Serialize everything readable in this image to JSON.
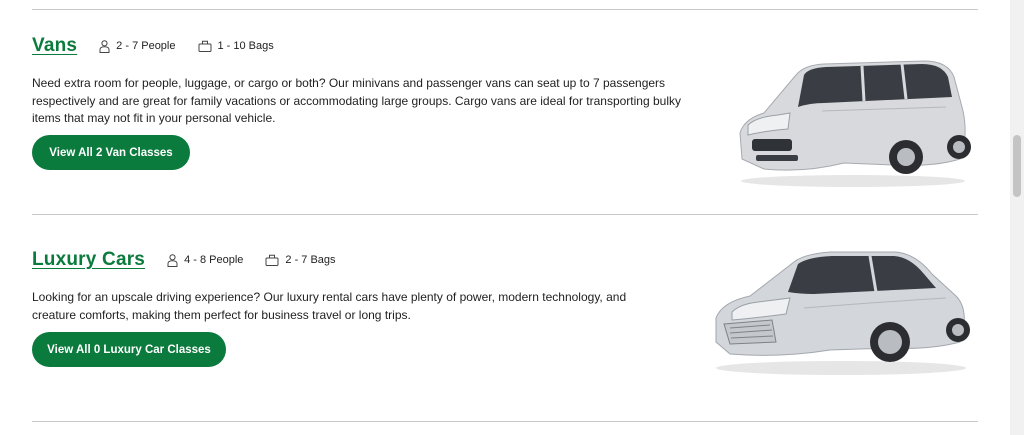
{
  "sections": [
    {
      "title": "Vans",
      "people": "2 - 7 People",
      "bags": "1 - 10 Bags",
      "description_lines": [
        "Need extra room for people, luggage, or cargo or both? Our minivans and passenger vans can seat up to 7 passengers",
        "respectively and are great for family vacations or accommodating large groups. Cargo vans are ideal for transporting bulky",
        "items that may not fit in your personal vehicle."
      ],
      "button_label": "View All 2 Van Classes"
    },
    {
      "title": "Luxury Cars",
      "people": "4 - 8 People",
      "bags": "2 - 7 Bags",
      "description_lines": [
        "Looking for an upscale driving experience? Our luxury rental cars have plenty of power, modern technology, and",
        "creature comforts, making them perfect for business travel or long trips."
      ],
      "button_label": "View All 0 Luxury Car Classes"
    }
  ],
  "colors": {
    "accent": "#0b7a3d",
    "divider": "#c9c9c9"
  },
  "icons": {
    "people": "person-icon",
    "bags": "bag-icon"
  }
}
